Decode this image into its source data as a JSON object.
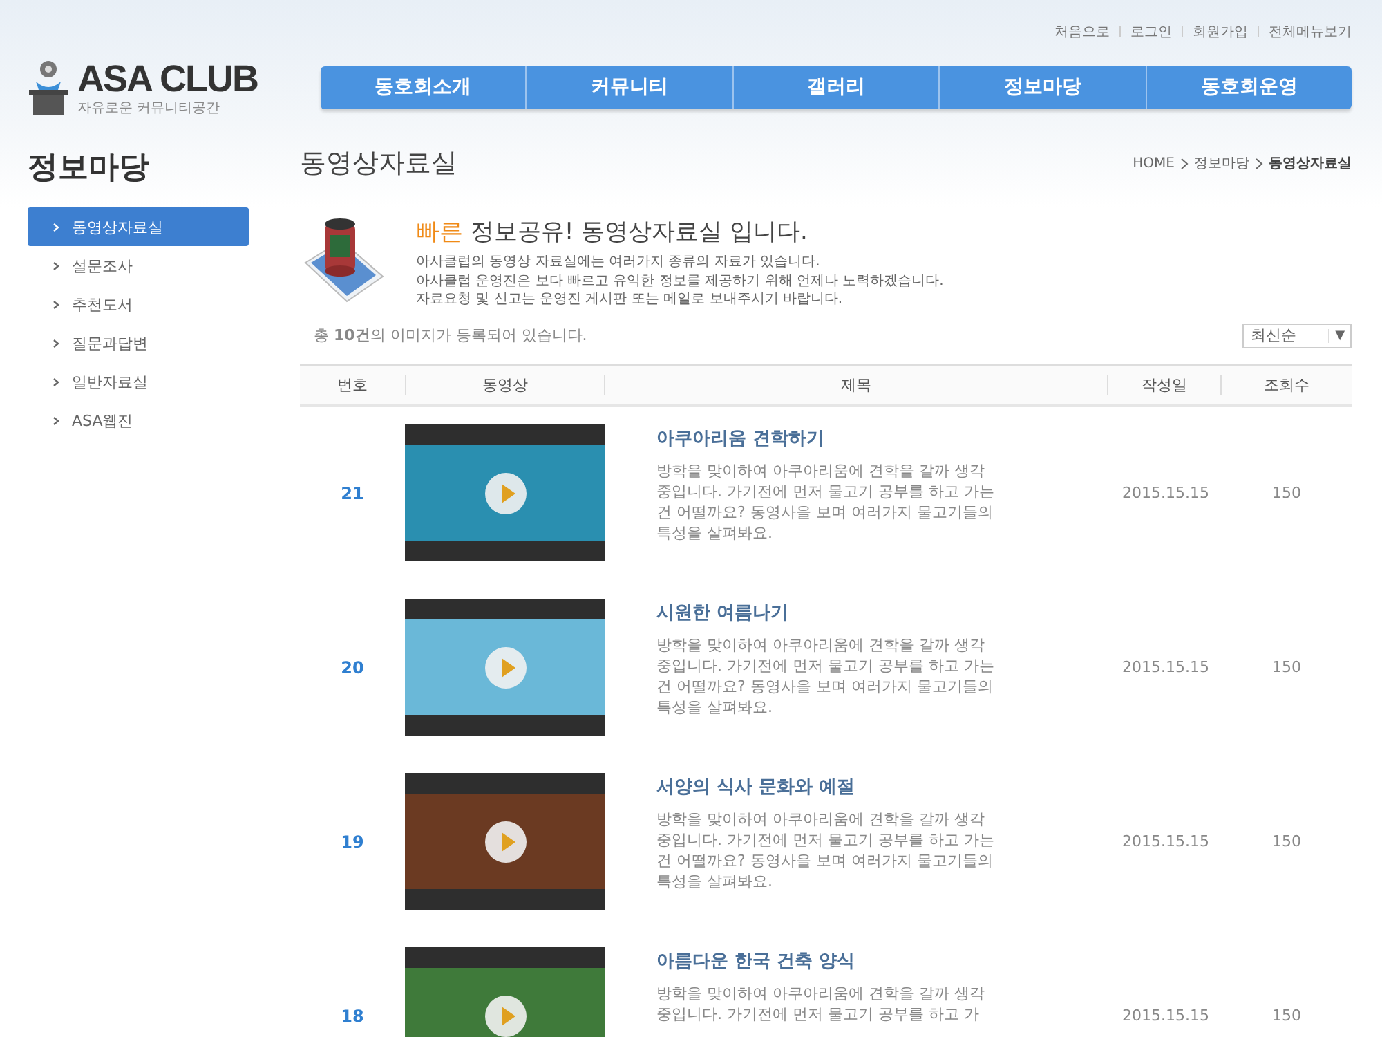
{
  "top_links": [
    "처음으로",
    "로그인",
    "회원가입",
    "전체메뉴보기"
  ],
  "logo": {
    "title": "ASA CLUB",
    "subtitle": "자유로운 커뮤니티공간"
  },
  "nav": [
    {
      "label": "동호회소개",
      "selected": false
    },
    {
      "label": "커뮤니티",
      "selected": false
    },
    {
      "label": "갤러리",
      "selected": false
    },
    {
      "label": "정보마당",
      "selected": false
    },
    {
      "label": "동호회운영",
      "selected": false
    }
  ],
  "sidebar": {
    "title": "정보마당",
    "items": [
      {
        "label": "동영상자료실",
        "selected": true
      },
      {
        "label": "설문조사",
        "selected": false
      },
      {
        "label": "추천도서",
        "selected": false
      },
      {
        "label": "질문과답변",
        "selected": false
      },
      {
        "label": "일반자료실",
        "selected": false
      },
      {
        "label": "ASA웹진",
        "selected": false
      }
    ]
  },
  "page_title": "동영상자료실",
  "breadcrumb": [
    "HOME",
    "정보마당",
    "동영상자료실"
  ],
  "intro": {
    "headline": "빠른",
    "headline_rest": "정보공유! 동영상자료실 입니다.",
    "lines": [
      "아사클럽의 동영상 자료실에는 여러가지 종류의 자료가 있습니다.",
      "아사클럽 운영진은 보다 빠르고 유익한 정보를 제공하기 위해 언제나 노력하겠습니다.",
      "자료요청 및 신고는 운영진 게시판 또는 메일로 보내주시기 바랍니다."
    ]
  },
  "count_text": "총 **10건**의 이미지가 등록되어 있습니다.",
  "sort": {
    "value": "최신순",
    "arrow": "▼"
  },
  "table": {
    "columns": [
      "번호",
      "동영상",
      "제목",
      "작성일",
      "조회수"
    ],
    "rows": [
      {
        "no": "21",
        "title": "아쿠아리움 견학하기",
        "description": "방학을 맞이하여 아쿠아리움에 견학을 갈까 생각 중입니다. 가기전에 먼저 물고기 공부를 하고 가는건 어떨까요? 동영사을 보며 여러가지 물고기들의 특성을 살펴봐요.",
        "date": "2015.15.15",
        "views": "150",
        "color": "#2a8fb0"
      },
      {
        "no": "20",
        "title": "시원한 여름나기",
        "description": "방학을 맞이하여 아쿠아리움에 견학을 갈까 생각 중입니다. 가기전에 먼저 물고기 공부를 하고 가는건 어떨까요? 동영사을 보며 여러가지 물고기들의 특성을 살펴봐요.",
        "date": "2015.15.15",
        "views": "150",
        "color": "#6ab8d8"
      },
      {
        "no": "19",
        "title": "서양의 식사 문화와 예절",
        "description": "방학을 맞이하여 아쿠아리움에 견학을 갈까 생각 중입니다. 가기전에 먼저 물고기 공부를 하고 가는건 어떨까요? 동영사을 보며 여러가지 물고기들의 특성을 살펴봐요.",
        "date": "2015.15.15",
        "views": "150",
        "color": "#6b3a22"
      },
      {
        "no": "18",
        "title": "아름다운 한국 건축 양식",
        "description": "방학을 맞이하여 아쿠아리움에 견학을 갈까 생각 중입니다. 가기전에 먼저 물고기 공부를 하고 가",
        "date": "2015.15.15",
        "views": "150",
        "color": "#3f7a3a"
      }
    ]
  }
}
